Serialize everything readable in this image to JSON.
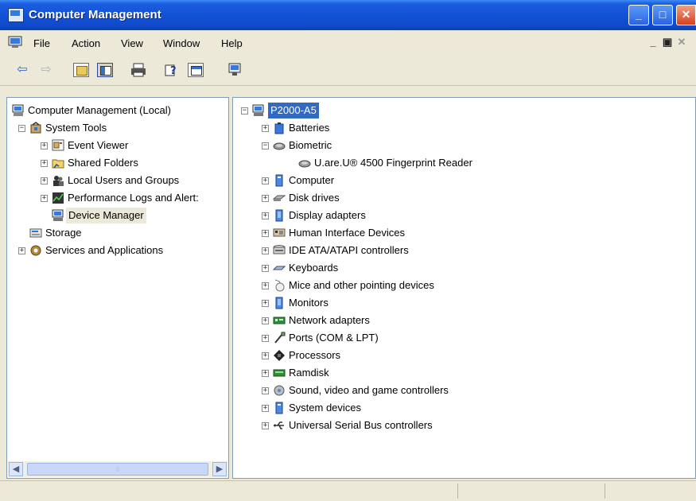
{
  "window": {
    "title": "Computer Management"
  },
  "menu": [
    {
      "label": "File"
    },
    {
      "label": "Action"
    },
    {
      "label": "View"
    },
    {
      "label": "Window"
    },
    {
      "label": "Help"
    }
  ],
  "toolbar": {
    "back_icon": "back-arrow-icon",
    "forward_icon": "forward-arrow-icon"
  },
  "left_tree": {
    "root": "Computer Management (Local)",
    "system_tools": "System Tools",
    "event_viewer": "Event Viewer",
    "shared_folders": "Shared Folders",
    "local_users": "Local Users and Groups",
    "perf_logs": "Performance Logs and Alert:",
    "device_manager": "Device Manager",
    "storage": "Storage",
    "services": "Services and Applications"
  },
  "right_tree": {
    "computer_name": "P2000-A5",
    "categories": [
      {
        "label": "Batteries",
        "expanded": false
      },
      {
        "label": "Biometric",
        "expanded": true
      },
      {
        "label": "U.are.U® 4500 Fingerprint Reader",
        "child": true
      },
      {
        "label": "Computer",
        "expanded": false
      },
      {
        "label": "Disk drives",
        "expanded": false
      },
      {
        "label": "Display adapters",
        "expanded": false
      },
      {
        "label": "Human Interface Devices",
        "expanded": false
      },
      {
        "label": "IDE ATA/ATAPI controllers",
        "expanded": false
      },
      {
        "label": "Keyboards",
        "expanded": false
      },
      {
        "label": "Mice and other pointing devices",
        "expanded": false
      },
      {
        "label": "Monitors",
        "expanded": false
      },
      {
        "label": "Network adapters",
        "expanded": false
      },
      {
        "label": "Ports (COM & LPT)",
        "expanded": false
      },
      {
        "label": "Processors",
        "expanded": false
      },
      {
        "label": "Ramdisk",
        "expanded": false
      },
      {
        "label": "Sound, video and game controllers",
        "expanded": false
      },
      {
        "label": "System devices",
        "expanded": false
      },
      {
        "label": "Universal Serial Bus controllers",
        "expanded": false
      }
    ]
  },
  "colors": {
    "titlebar": "#1352d6",
    "selection": "#316ac5",
    "chrome": "#ece9d8"
  }
}
